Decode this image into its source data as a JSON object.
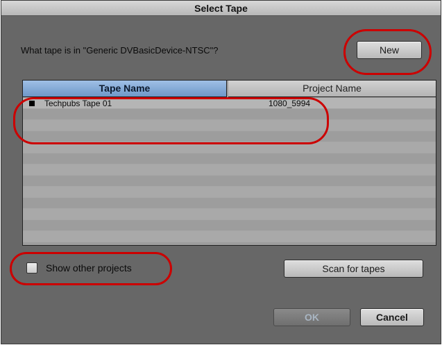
{
  "window": {
    "title": "Select Tape"
  },
  "prompt": {
    "question": "What tape is in \"Generic DVBasicDevice-NTSC\"?"
  },
  "buttons": {
    "new": "New",
    "scan": "Scan for tapes",
    "ok": "OK",
    "cancel": "Cancel"
  },
  "table": {
    "columns": [
      "Tape Name",
      "Project Name"
    ],
    "sorted_column": "Tape Name",
    "rows": [
      {
        "tape_name": "Techpubs Tape 01",
        "project_name": "1080_5994"
      }
    ]
  },
  "options": {
    "show_other_projects_label": "Show other projects",
    "show_other_projects_checked": false
  },
  "colors": {
    "dialog_bg": "#676767",
    "selected_header": "#7fa6d6",
    "highlight_annotation": "#cc0000"
  }
}
